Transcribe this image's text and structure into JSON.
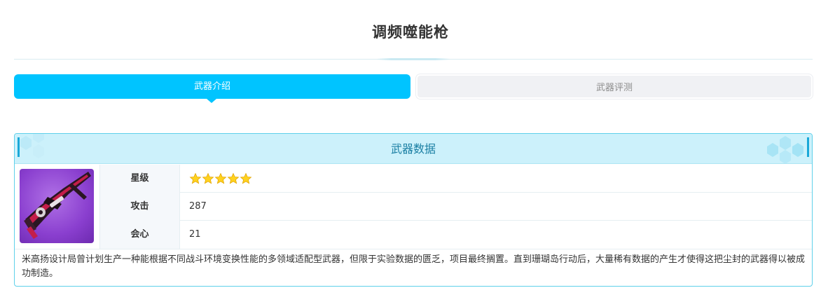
{
  "page": {
    "title": "调频噬能枪"
  },
  "tabs": [
    {
      "label": "武器介绍",
      "active": true
    },
    {
      "label": "武器评测",
      "active": false
    }
  ],
  "card": {
    "header": "武器数据",
    "image_icon": "weapon-image",
    "rows": {
      "rarity": {
        "label": "星级",
        "stars": 5
      },
      "attack": {
        "label": "攻击",
        "value": "287"
      },
      "crit": {
        "label": "会心",
        "value": "21"
      }
    },
    "description": "米高扬设计局曾计划生产一种能根据不同战斗环境变换性能的多领域适配型武器，但限于实验数据的匮乏，项目最终搁置。直到珊瑚岛行动后，大量稀有数据的产生才使得这把尘封的武器得以被成功制造。"
  },
  "colors": {
    "accent": "#00c4ff",
    "header_bg": "#ccf1fb",
    "header_text": "#1a7fa3",
    "star": "#ffd21f"
  }
}
